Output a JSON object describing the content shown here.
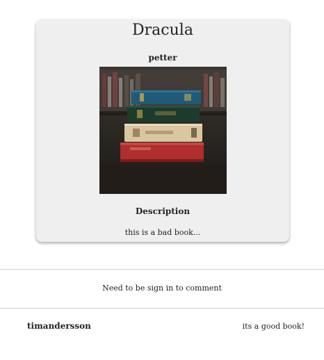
{
  "book": {
    "title": "Dracula",
    "author": "petter",
    "cover_image": "stack-of-old-books-image",
    "description_heading": "Description",
    "description": "this is a bad book..."
  },
  "comments_section": {
    "signin_notice": "Need to be sign in to comment",
    "comments": [
      {
        "user": "timandersson",
        "text": "its a good book!"
      }
    ]
  },
  "colors": {
    "card_background": "#efefef",
    "divider": "#cfcfcf",
    "text": "#222222"
  }
}
